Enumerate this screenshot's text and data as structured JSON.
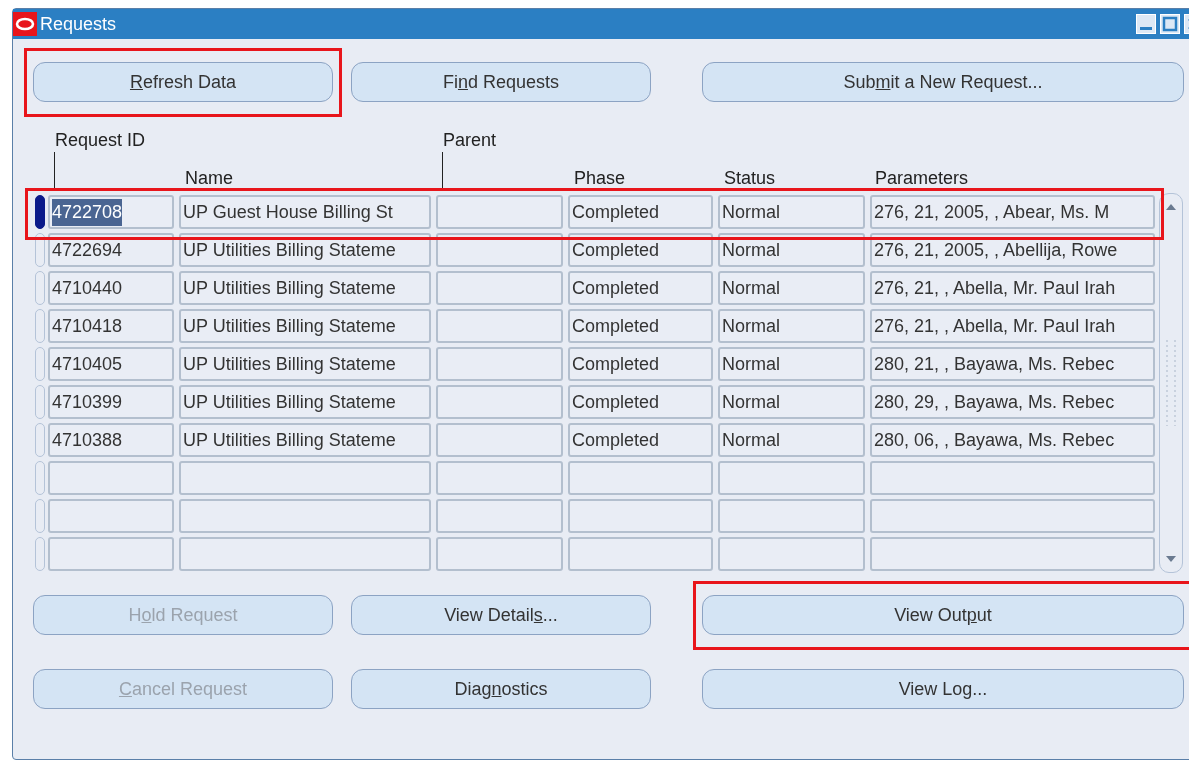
{
  "window": {
    "title": "Requests"
  },
  "top_buttons": [
    {
      "key": "R",
      "after": "efresh Data",
      "disabled": false,
      "highlighted": true
    },
    {
      "before": "Fi",
      "key": "n",
      "after": "d Requests",
      "disabled": false,
      "highlighted": false
    },
    {
      "before": "Sub",
      "key": "m",
      "after": "it a New Request...",
      "disabled": false,
      "highlighted": false
    }
  ],
  "table": {
    "columns": [
      {
        "label": "Request ID",
        "kind": "upper"
      },
      {
        "label": "Name",
        "kind": "lower"
      },
      {
        "label": "Parent",
        "kind": "upper"
      },
      {
        "label": "Phase",
        "kind": "lower"
      },
      {
        "label": "Status",
        "kind": "lower"
      },
      {
        "label": "Parameters",
        "kind": "lower"
      }
    ],
    "rows": [
      {
        "kind": "record",
        "selected": true,
        "highlighted": true,
        "request_id": "4722708",
        "name": "UP Guest House Billing St",
        "phase": "Completed",
        "status": "Normal",
        "parameters": "276, 21, 2005, , Abear, Ms. M"
      },
      {
        "kind": "record",
        "selected": false,
        "highlighted": false,
        "request_id": "4722694",
        "name": "UP Utilities Billing Stateme",
        "phase": "Completed",
        "status": "Normal",
        "parameters": "276, 21, 2005, , Abellija, Rowe"
      },
      {
        "kind": "record",
        "selected": false,
        "highlighted": false,
        "request_id": "4710440",
        "name": "UP Utilities Billing Stateme",
        "phase": "Completed",
        "status": "Normal",
        "parameters": "276, 21, , Abella, Mr. Paul Irah"
      },
      {
        "kind": "record",
        "selected": false,
        "highlighted": false,
        "request_id": "4710418",
        "name": "UP Utilities Billing Stateme",
        "phase": "Completed",
        "status": "Normal",
        "parameters": "276, 21, , Abella, Mr. Paul Irah"
      },
      {
        "kind": "record",
        "selected": false,
        "highlighted": false,
        "request_id": "4710405",
        "name": "UP Utilities Billing Stateme",
        "phase": "Completed",
        "status": "Normal",
        "parameters": "280, 21, , Bayawa, Ms. Rebec"
      },
      {
        "kind": "record",
        "selected": false,
        "highlighted": false,
        "request_id": "4710399",
        "name": "UP Utilities Billing Stateme",
        "phase": "Completed",
        "status": "Normal",
        "parameters": "280, 29, , Bayawa, Ms. Rebec"
      },
      {
        "kind": "record",
        "selected": false,
        "highlighted": false,
        "request_id": "4710388",
        "name": "UP Utilities Billing Stateme",
        "phase": "Completed",
        "status": "Normal",
        "parameters": "280, 06, , Bayawa, Ms. Rebec"
      },
      {
        "kind": "blank",
        "selected": false,
        "highlighted": false
      },
      {
        "kind": "blank",
        "selected": false,
        "highlighted": false
      },
      {
        "kind": "blank",
        "selected": false,
        "highlighted": false
      }
    ]
  },
  "bottom_buttons": [
    {
      "before": "H",
      "key": "o",
      "after": "ld Request",
      "disabled": true,
      "highlighted": false
    },
    {
      "before": "View Detail",
      "key": "s",
      "after": "...",
      "disabled": false,
      "highlighted": false
    },
    {
      "before": "View Out",
      "key": "p",
      "after": "ut",
      "disabled": false,
      "highlighted": true
    },
    {
      "key": "C",
      "after": "ancel Request",
      "disabled": true,
      "highlighted": false
    },
    {
      "before": "Diag",
      "key": "n",
      "after": "ostics",
      "disabled": false,
      "highlighted": false
    },
    {
      "before": "View Log...",
      "disabled": false,
      "highlighted": false
    }
  ]
}
